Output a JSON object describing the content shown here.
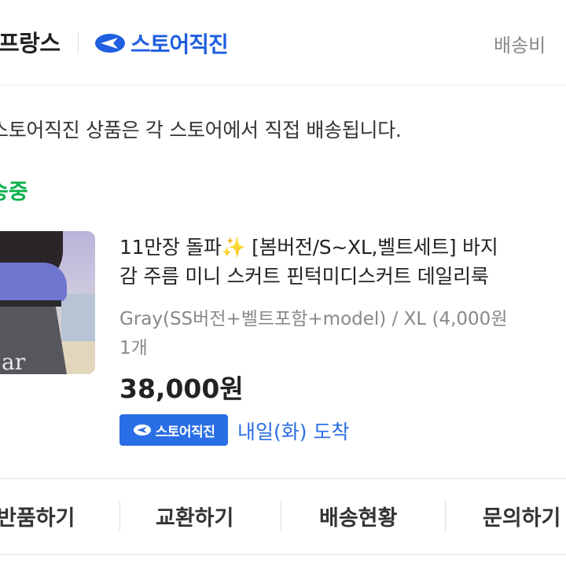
{
  "header": {
    "store_name": "프랑스",
    "badge_label": "스토어직진",
    "shipping_link": "배송비"
  },
  "notice": "스토어직진 상품은 각 스토어에서 직접 배송됩니다.",
  "status": "송중",
  "product": {
    "title_line1": "11만장 돌파✨ [봄버전/S~XL,벨트세트] 바지",
    "title_line2": "감 주름 미니 스커트 핀턱미디스커트 데일리룩",
    "option": "Gray(SS버전+벨트포함+model) / XL  (4,000원",
    "quantity": "1개",
    "price": "38,000원",
    "thumbnail_watermark": "ar",
    "delivery_badge": "스토어직진",
    "arrival": "내일(화) 도착"
  },
  "actions": [
    "반품하기",
    "교환하기",
    "배송현황",
    "문의하기"
  ],
  "colors": {
    "accent_blue": "#2a6ee6",
    "status_green": "#0bb04c"
  }
}
